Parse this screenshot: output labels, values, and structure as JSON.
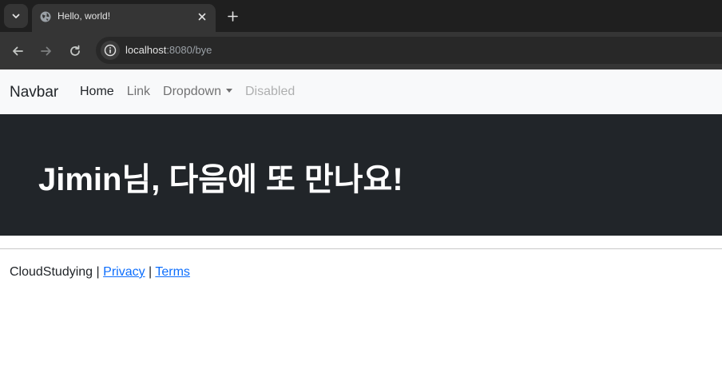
{
  "browser": {
    "tab": {
      "title": "Hello, world!"
    },
    "address": {
      "host": "localhost",
      "path": ":8080/bye"
    },
    "colors": {
      "chrome_dark": "#1f1f1f",
      "chrome_mid": "#353535",
      "icon": "#c4c7c5"
    },
    "icons": [
      "chevron-down-icon",
      "globe-icon",
      "close-icon",
      "plus-icon",
      "back-arrow-icon",
      "forward-arrow-icon",
      "reload-icon",
      "info-icon"
    ]
  },
  "navbar": {
    "brand": "Navbar",
    "links": [
      {
        "label": "Home",
        "state": "active"
      },
      {
        "label": "Link",
        "state": "normal"
      },
      {
        "label": "Dropdown",
        "state": "dropdown"
      },
      {
        "label": "Disabled",
        "state": "disabled"
      }
    ]
  },
  "hero": {
    "title": "Jimin님, 다음에 또 만나요!",
    "background": "#212529"
  },
  "footer": {
    "brand": "CloudStudying",
    "separator": "|",
    "privacy": "Privacy",
    "terms": "Terms",
    "link_color": "#0d6efd"
  }
}
